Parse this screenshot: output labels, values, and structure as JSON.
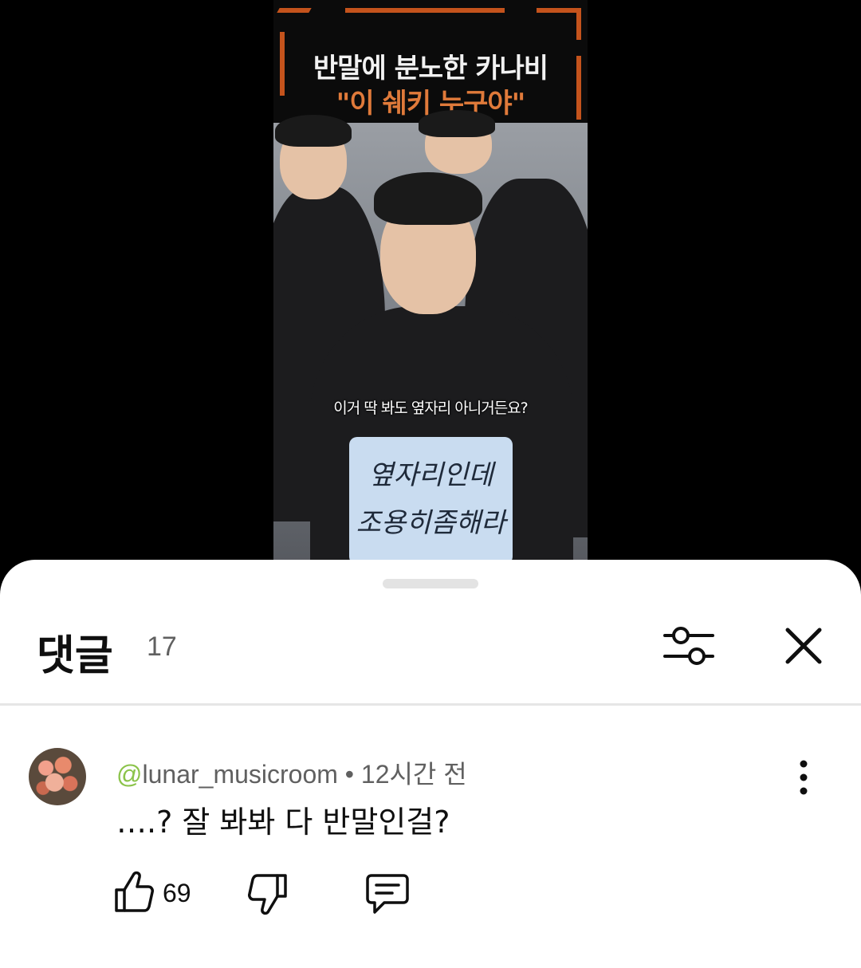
{
  "video": {
    "title_line1": "반말에 분노한 카나비",
    "title_line2": "\"이 쉐키 누구야\"",
    "subtitle": "이거 딱 봐도 옆자리 아니거든요?",
    "sign_line1": "옆자리인데",
    "sign_line2": "조용히좀해라"
  },
  "comments_panel": {
    "title": "댓글",
    "count": "17",
    "icons": {
      "filter": "sliders-icon",
      "close": "close-icon"
    }
  },
  "comment": {
    "at_symbol": "@",
    "username": "lunar_musicroom",
    "separator": " • ",
    "time": "12시간 전",
    "text": "….? 잘 봐봐 다 반말인걸?",
    "like_count": "69",
    "icons": {
      "like": "thumbs-up-icon",
      "dislike": "thumbs-down-icon",
      "reply": "reply-icon",
      "more": "more-vertical-icon"
    }
  },
  "colors": {
    "accent_orange": "#c4531c",
    "handle_gray": "#e3e3e3",
    "username_at": "#8bc34a"
  }
}
